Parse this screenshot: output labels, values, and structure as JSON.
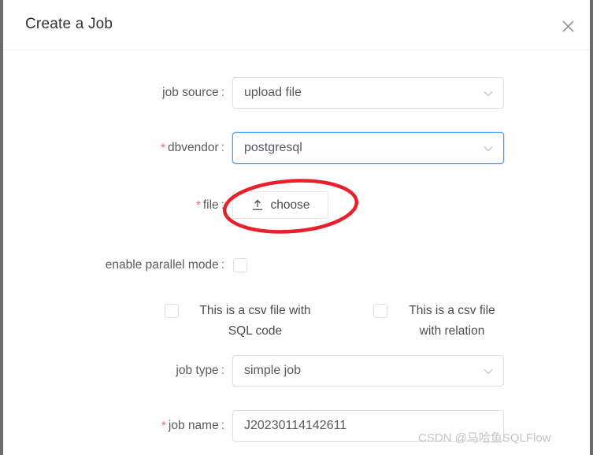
{
  "dialog": {
    "title": "Create a Job",
    "close_icon": "close-icon"
  },
  "form": {
    "rows": [
      {
        "label": "job source",
        "required": false,
        "type": "select",
        "value": "upload file"
      },
      {
        "label": "dbvendor",
        "required": true,
        "type": "select",
        "value": "postgresql",
        "focused": true
      },
      {
        "label": "file",
        "required": true,
        "type": "upload",
        "button_label": "choose"
      },
      {
        "label": "enable parallel mode",
        "required": false,
        "type": "checkbox",
        "checked": false
      },
      {
        "label": "job type",
        "required": false,
        "type": "select",
        "value": "simple job"
      },
      {
        "label": "job name",
        "required": true,
        "type": "input",
        "value": "J20230114142611"
      }
    ],
    "csv_options": [
      {
        "label": "This is a csv file with SQL code",
        "checked": false
      },
      {
        "label": "This is a csv file with relation",
        "checked": false
      }
    ],
    "colon": ":"
  },
  "annotation": {
    "shape": "ellipse",
    "color": "#e8202a",
    "target": "choose-button"
  },
  "watermark": {
    "text": "CSDN @马哈鱼SQLFlow"
  },
  "colors": {
    "accent": "#409eff",
    "required": "#f56c6c",
    "border": "#dcdfe6",
    "text": "#5a5a5a",
    "annotation": "#e8202a"
  }
}
